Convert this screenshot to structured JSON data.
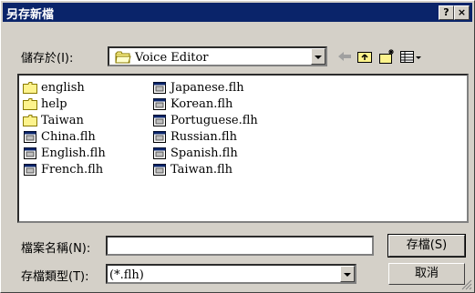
{
  "window": {
    "title": "另存新檔",
    "help_label": "?",
    "close_label": "×"
  },
  "save_in": {
    "label": "儲存於(I):",
    "folder": "Voice Editor"
  },
  "files": {
    "folders": [
      "english",
      "help",
      "Taiwan"
    ],
    "col1_files": [
      "China.flh",
      "English.flh",
      "French.flh"
    ],
    "col2_files": [
      "Japanese.flh",
      "Korean.flh",
      "Portuguese.flh",
      "Russian.flh",
      "Spanish.flh",
      "Taiwan.flh"
    ]
  },
  "filename": {
    "label": "檔案名稱(N):",
    "value": ""
  },
  "filetype": {
    "label": "存檔類型(T):",
    "value": "(*.flh)"
  },
  "buttons": {
    "save": "存檔(S)",
    "cancel": "取消"
  },
  "icons": {
    "folder": "folder-icon",
    "file": "flh-file-icon",
    "back": "back-arrow-icon",
    "up": "up-folder-icon",
    "new_folder": "new-folder-icon",
    "view": "view-menu-icon"
  }
}
